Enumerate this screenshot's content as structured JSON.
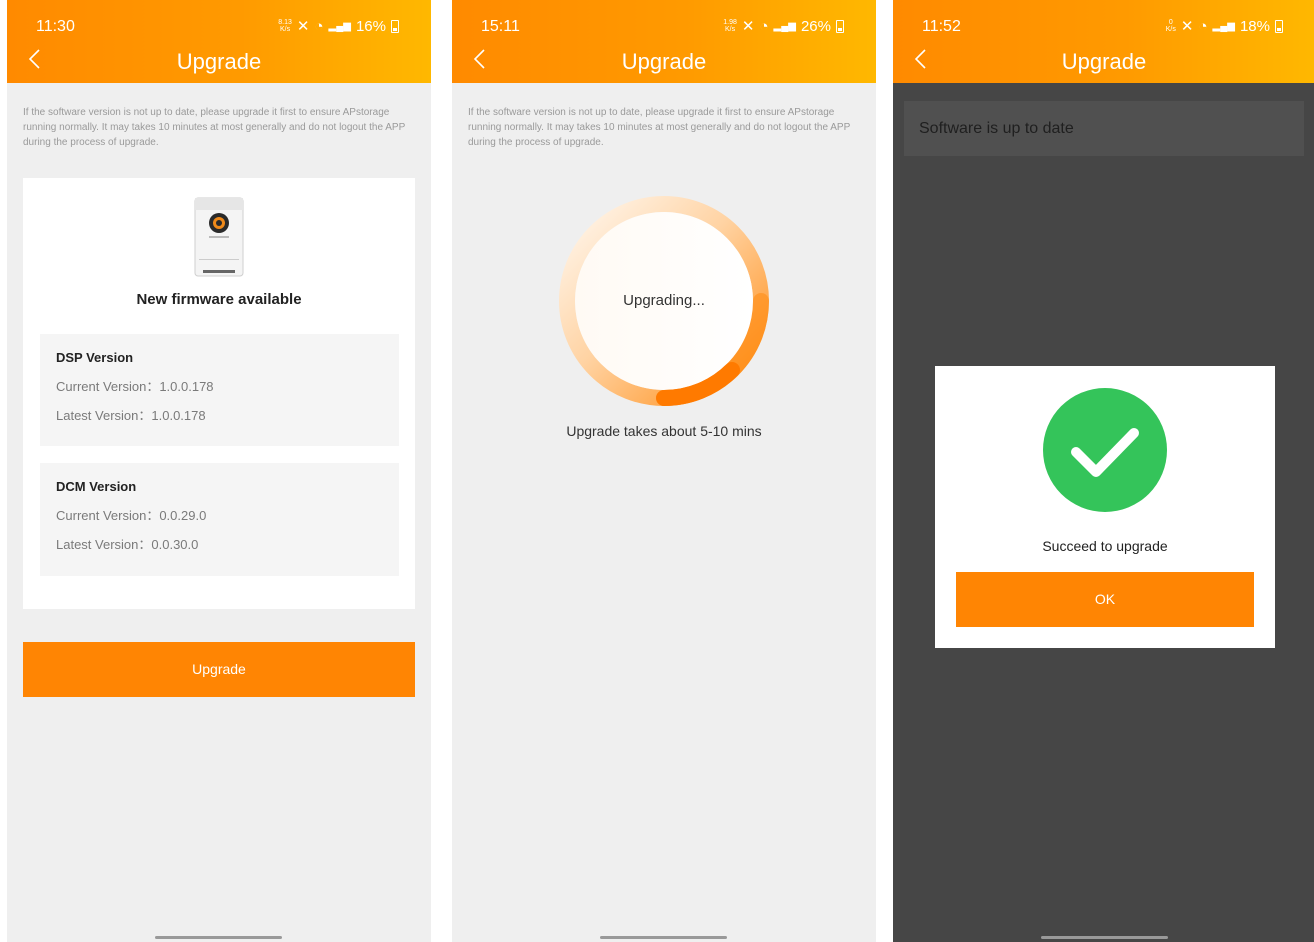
{
  "screens": [
    {
      "status_time": "11:30",
      "speed_top": "8.13",
      "speed_unit": "K/s",
      "battery": "16%",
      "title": "Upgrade",
      "intro": "If the software version is not up to date, please upgrade it first to ensure APstorage running normally. It may takes 10 minutes at most generally and do not logout the APP during the process of upgrade.",
      "firmware_heading": "New firmware available",
      "dsp": {
        "title": "DSP Version",
        "current": "Current Version：1.0.0.178",
        "latest": "Latest Version：1.0.0.178"
      },
      "dcm": {
        "title": "DCM Version",
        "current": "Current Version：0.0.29.0",
        "latest": "Latest Version：0.0.30.0"
      },
      "upgrade_button": "Upgrade"
    },
    {
      "status_time": "15:11",
      "speed_top": "1.98",
      "speed_unit": "K/s",
      "battery": "26%",
      "title": "Upgrade",
      "intro": "If the software version is not up to date, please upgrade it first to ensure APstorage running normally. It may takes 10 minutes at most generally and do not logout the APP during the process of upgrade.",
      "progress_label": "Upgrading...",
      "eta": "Upgrade takes about 5-10 mins"
    },
    {
      "status_time": "11:52",
      "speed_top": "0",
      "speed_unit": "K/s",
      "battery": "18%",
      "title": "Upgrade",
      "banner": "Software is up to date",
      "dialog_message": "Succeed to upgrade",
      "ok_button": "OK"
    }
  ],
  "colors": {
    "accent": "#ff8503",
    "success": "#34c45a"
  }
}
